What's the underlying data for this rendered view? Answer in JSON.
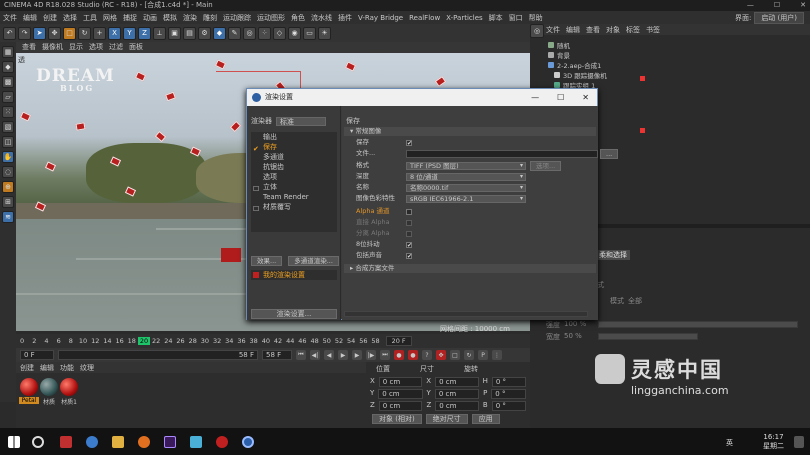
{
  "window": {
    "title": "CINEMA 4D R18.028 Studio (RC - R18) - [合成1.c4d *] - Main",
    "controls": [
      "—",
      "☐",
      "✕"
    ]
  },
  "menubar": {
    "items": [
      "文件",
      "编辑",
      "创建",
      "选择",
      "工具",
      "网格",
      "捕捉",
      "动画",
      "模拟",
      "渲染",
      "雕刻",
      "运动跟踪",
      "运动图形",
      "角色",
      "流水线",
      "插件",
      "V-Ray Bridge",
      "RealFlow",
      "X-Particles",
      "脚本",
      "窗口",
      "帮助"
    ],
    "layout_label": "界面:",
    "layout_value": "启动 (用户)"
  },
  "viewport": {
    "menu": [
      "查看",
      "摄像机",
      "显示",
      "选项",
      "过滤",
      "面板"
    ],
    "corner_label": "透",
    "logo_line1": "DREAM",
    "logo_line2": "BLOG",
    "grid_label": "网格间距 : 10000 cm"
  },
  "timeline": {
    "ticks": [
      "2",
      "4",
      "6",
      "8",
      "10",
      "12",
      "14",
      "16",
      "18",
      "20",
      "22",
      "24",
      "26",
      "28",
      "30",
      "32",
      "34",
      "36",
      "38",
      "40",
      "42",
      "44",
      "46",
      "48",
      "50",
      "52",
      "54",
      "56",
      "58",
      "0"
    ],
    "current_frame": "20",
    "current_frame_field": "20 F",
    "start_field": "0 F",
    "end_field": "58 F",
    "fps_field": "58 F"
  },
  "materials": {
    "menu": [
      "创建",
      "编辑",
      "功能",
      "纹理"
    ],
    "items": [
      "Petal",
      "材质",
      "材质1"
    ]
  },
  "coords": {
    "headers": [
      "位置",
      "尺寸",
      "旋转"
    ],
    "rows": [
      {
        "axis": "X",
        "pos": "0 cm",
        "size": "0 cm",
        "rot_axis": "H",
        "rot": "0 °"
      },
      {
        "axis": "Y",
        "pos": "0 cm",
        "size": "0 cm",
        "rot_axis": "P",
        "rot": "0 °"
      },
      {
        "axis": "Z",
        "pos": "0 cm",
        "size": "0 cm",
        "rot_axis": "B",
        "rot": "0 °"
      }
    ],
    "mode_select": "对象 (相对)",
    "size_select": "绝对尺寸",
    "apply": "应用"
  },
  "objects": {
    "menu": [
      "文件",
      "编辑",
      "查看",
      "对象",
      "标签",
      "书签"
    ],
    "items": [
      "随机",
      "背景",
      "2-2.aep-合成1",
      "3D 跟踪摄像机",
      "跟踪实组 1"
    ]
  },
  "attributes": {
    "header": "数据",
    "tab": "柔和选择",
    "mode_label": "模式",
    "mode_value": "全部",
    "strength_label": "强度",
    "strength_value": "100 %",
    "width_label": "宽度",
    "width_value": "50 %",
    "strength": 1.0,
    "width": 0.5
  },
  "dialog": {
    "title": "渲染设置",
    "controls": [
      "—",
      "☐",
      "✕"
    ],
    "renderer_label": "渲染器",
    "renderer_value": "标准",
    "list": [
      "输出",
      "保存",
      "多通道",
      "抗锯齿",
      "选项",
      "立体",
      "Team Render",
      "材质覆写"
    ],
    "active_index": 1,
    "effect_button": "效果...",
    "multipass_button": "多通道渲染...",
    "my_settings": "我的渲染设置",
    "render_settings_button": "渲染设置...",
    "right_title": "保存",
    "sections": {
      "general": "▾ 常规图像",
      "composite": "▸ 合成方案文件"
    },
    "fields": {
      "save_label": "保存",
      "file_label": "文件...",
      "file_browse": "...",
      "format_label": "格式",
      "format_value": "TIFF (PSD 图层)",
      "options_button": "选项...",
      "depth_label": "深度",
      "depth_value": "8 位/通道",
      "name_label": "名称",
      "name_value": "名称0000.tif",
      "profile_label": "图像色彩特性",
      "profile_value": "sRGB IEC61966-2.1",
      "alpha_label": "Alpha 通道",
      "straight_alpha_label": "直接 Alpha",
      "separate_alpha_label": "分离 Alpha",
      "dither_label": "8位抖动",
      "sound_label": "包括声音"
    }
  },
  "taskbar": {
    "time": "16:17",
    "day": "星期二",
    "lang": "英"
  },
  "watermark": {
    "cn": "灵感中国",
    "url": "lingganchina.com"
  }
}
